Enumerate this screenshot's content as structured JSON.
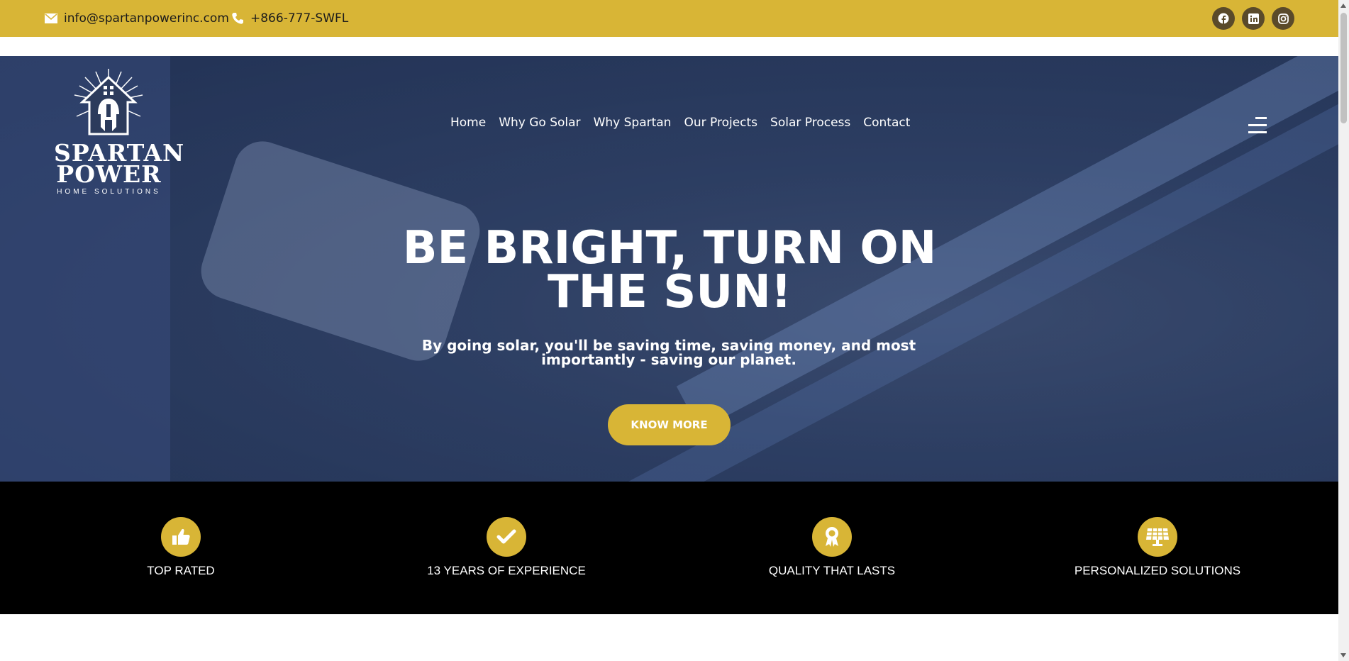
{
  "topbar": {
    "email": "info@spartanpowerinc.com",
    "phone": "+866-777-SWFL",
    "email_icon": "envelope-icon",
    "phone_icon": "phone-icon",
    "socials": [
      "facebook-icon",
      "linkedin-icon",
      "instagram-icon"
    ]
  },
  "logo": {
    "line1": "SPARTAN",
    "line2": "POWER",
    "tagline": "HOME SOLUTIONS"
  },
  "nav": {
    "items": [
      "Home",
      "Why Go Solar",
      "Why Spartan",
      "Our Projects",
      "Solar Process",
      "Contact"
    ],
    "menu_icon": "hamburger-menu-icon"
  },
  "hero": {
    "headline_line1": "BE BRIGHT, TURN ON",
    "headline_line2": "THE SUN!",
    "subtitle_line1": "By going solar, you'll be saving time, saving money, and most",
    "subtitle_line2": "importantly - saving our planet.",
    "cta_label": "KNOW MORE"
  },
  "features": [
    {
      "label": "TOP RATED",
      "icon": "thumbs-up-icon"
    },
    {
      "label": "13 YEARS OF EXPERIENCE",
      "icon": "checkmark-icon"
    },
    {
      "label": "QUALITY THAT LASTS",
      "icon": "award-ribbon-icon"
    },
    {
      "label": "PERSONALIZED SOLUTIONS",
      "icon": "solar-panel-icon"
    }
  ],
  "colors": {
    "brand_gold": "#d8b536",
    "dark": "#000000",
    "social_bg": "#5a4a2a"
  }
}
